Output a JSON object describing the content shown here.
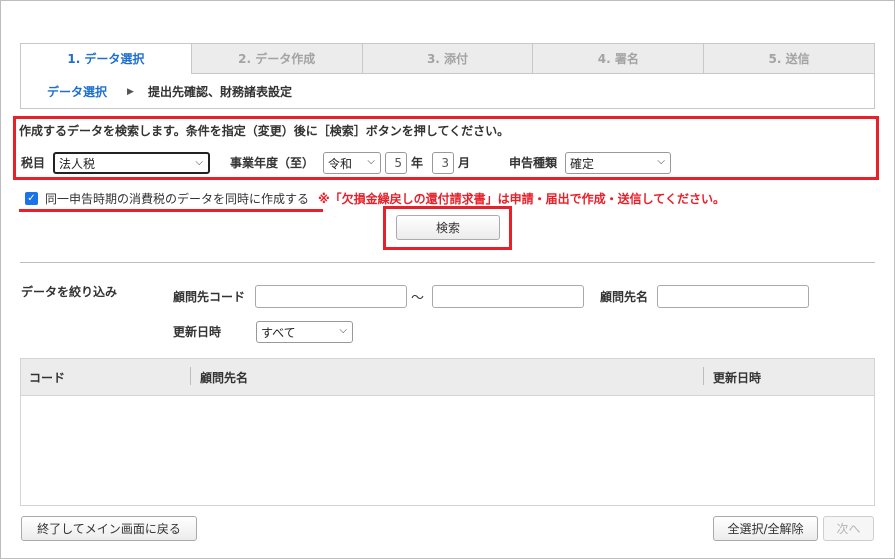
{
  "steps": [
    {
      "label": "1. データ選択",
      "active": true
    },
    {
      "label": "2. データ作成",
      "active": false
    },
    {
      "label": "3. 添付",
      "active": false
    },
    {
      "label": "4. 署名",
      "active": false
    },
    {
      "label": "5. 送信",
      "active": false
    }
  ],
  "substeps": {
    "current": "データ選択",
    "next": "提出先確認、財務諸表設定",
    "arrow": "▶"
  },
  "search": {
    "instruction": "作成するデータを検索します。条件を指定（変更）後に［検索］ボタンを押してください。",
    "tax_label": "税目",
    "tax_value": "法人税",
    "year_label": "事業年度（至）",
    "era_value": "令和",
    "year_value": "5",
    "year_unit": "年",
    "month_value": "3",
    "month_unit": "月",
    "filing_label": "申告種類",
    "filing_value": "確定",
    "checkbox_label": "同一申告時期の消費税のデータを同時に作成する",
    "checkbox_checked": true,
    "warning": "※「欠損金繰戻しの還付請求書」は申請・届出で作成・送信してください。",
    "search_button": "検索"
  },
  "filter": {
    "title": "データを絞り込み",
    "client_code_label": "顧問先コード",
    "range_sep": "～",
    "client_name_label": "顧問先名",
    "updated_label": "更新日時",
    "updated_value": "すべて"
  },
  "table": {
    "columns": [
      "コード",
      "顧問先名",
      "更新日時"
    ],
    "rows": []
  },
  "footer": {
    "exit_button": "終了してメイン画面に戻る",
    "select_all_button": "全選択/全解除",
    "next_button": "次へ"
  },
  "colors": {
    "accent": "#1f6fd1",
    "highlight": "#e8202a",
    "checkbox": "#1a73e8"
  }
}
